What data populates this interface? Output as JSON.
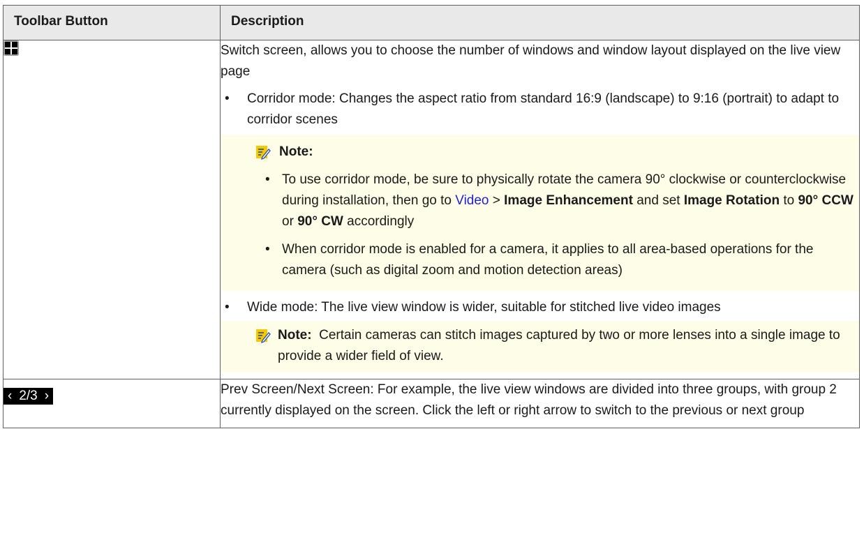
{
  "headers": {
    "col1": "Toolbar Button",
    "col2": "Description"
  },
  "row1": {
    "icon": "switch-screen-grid-icon",
    "intro": "Switch screen, allows you to choose the number of windows and window layout displayed on the live view page",
    "corridor": "Corridor mode: Changes the aspect ratio from standard 16:9 (landscape) to 9:16 (portrait) to adapt to corridor scenes",
    "note1_label": "Note:",
    "note1_b1": {
      "p1": "To use corridor mode, be sure to physically rotate the camera 90° clockwise or counterclockwise during installation, then go to ",
      "link": "Video",
      "p2": " > ",
      "b1": "Image Enhancement",
      "p3": " and set ",
      "b2": "Image Rotation",
      "p4": " to ",
      "b3": "90° CCW",
      "p5": " or ",
      "b4": "90° CW",
      "p6": " accordingly"
    },
    "note1_b2": "When corridor mode is enabled for a camera, it applies to all area-based operations for the camera (such as digital zoom and motion detection areas)",
    "wide": "Wide mode: The live view window is wider, suitable for stitched live video images",
    "note2_label": "Note:",
    "note2_text": "  Certain cameras can stitch images captured by two or more lenses into a single image to provide a wider field of view."
  },
  "row2": {
    "pager": {
      "prev": "‹",
      "label": "2/3",
      "next": "›"
    },
    "text": "Prev Screen/Next Screen: For example, the live view windows are divided into three groups, with group 2 currently displayed on the screen. Click the left or right arrow to switch to the previous or next group"
  },
  "colors": {
    "note_bg": "#fefde7",
    "link": "#1f1fd6",
    "header_bg": "#e9e9e9"
  }
}
